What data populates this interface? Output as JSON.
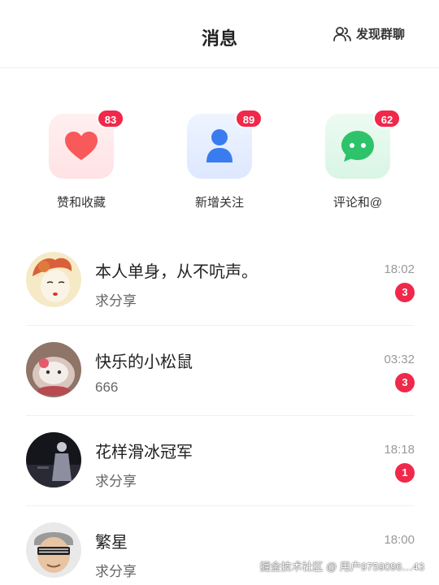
{
  "header": {
    "title": "消息",
    "group_button_label": "发现群聊",
    "group_icon": "users-icon"
  },
  "quick_actions": [
    {
      "label": "赞和收藏",
      "badge": "83",
      "icon": "heart-icon",
      "color": "#f85a5a"
    },
    {
      "label": "新增关注",
      "badge": "89",
      "icon": "user-icon",
      "color": "#3a7cf0"
    },
    {
      "label": "评论和@",
      "badge": "62",
      "icon": "chat-bubble-icon",
      "color": "#2ec36b"
    }
  ],
  "messages": [
    {
      "name": "本人单身，从不吭声。",
      "text": "求分享",
      "time": "18:02",
      "unread": "3"
    },
    {
      "name": "快乐的小松鼠",
      "text": "666",
      "time": "03:32",
      "unread": "3"
    },
    {
      "name": "花样滑冰冠军",
      "text": "求分享",
      "time": "18:18",
      "unread": "1"
    },
    {
      "name": "繁星",
      "text": "求分享",
      "time": "18:00",
      "unread": ""
    }
  ],
  "watermark": "掘金技术社区 @ 用户9759096…43",
  "colors": {
    "badge": "#f0284a",
    "divider": "#f0f0f0"
  }
}
